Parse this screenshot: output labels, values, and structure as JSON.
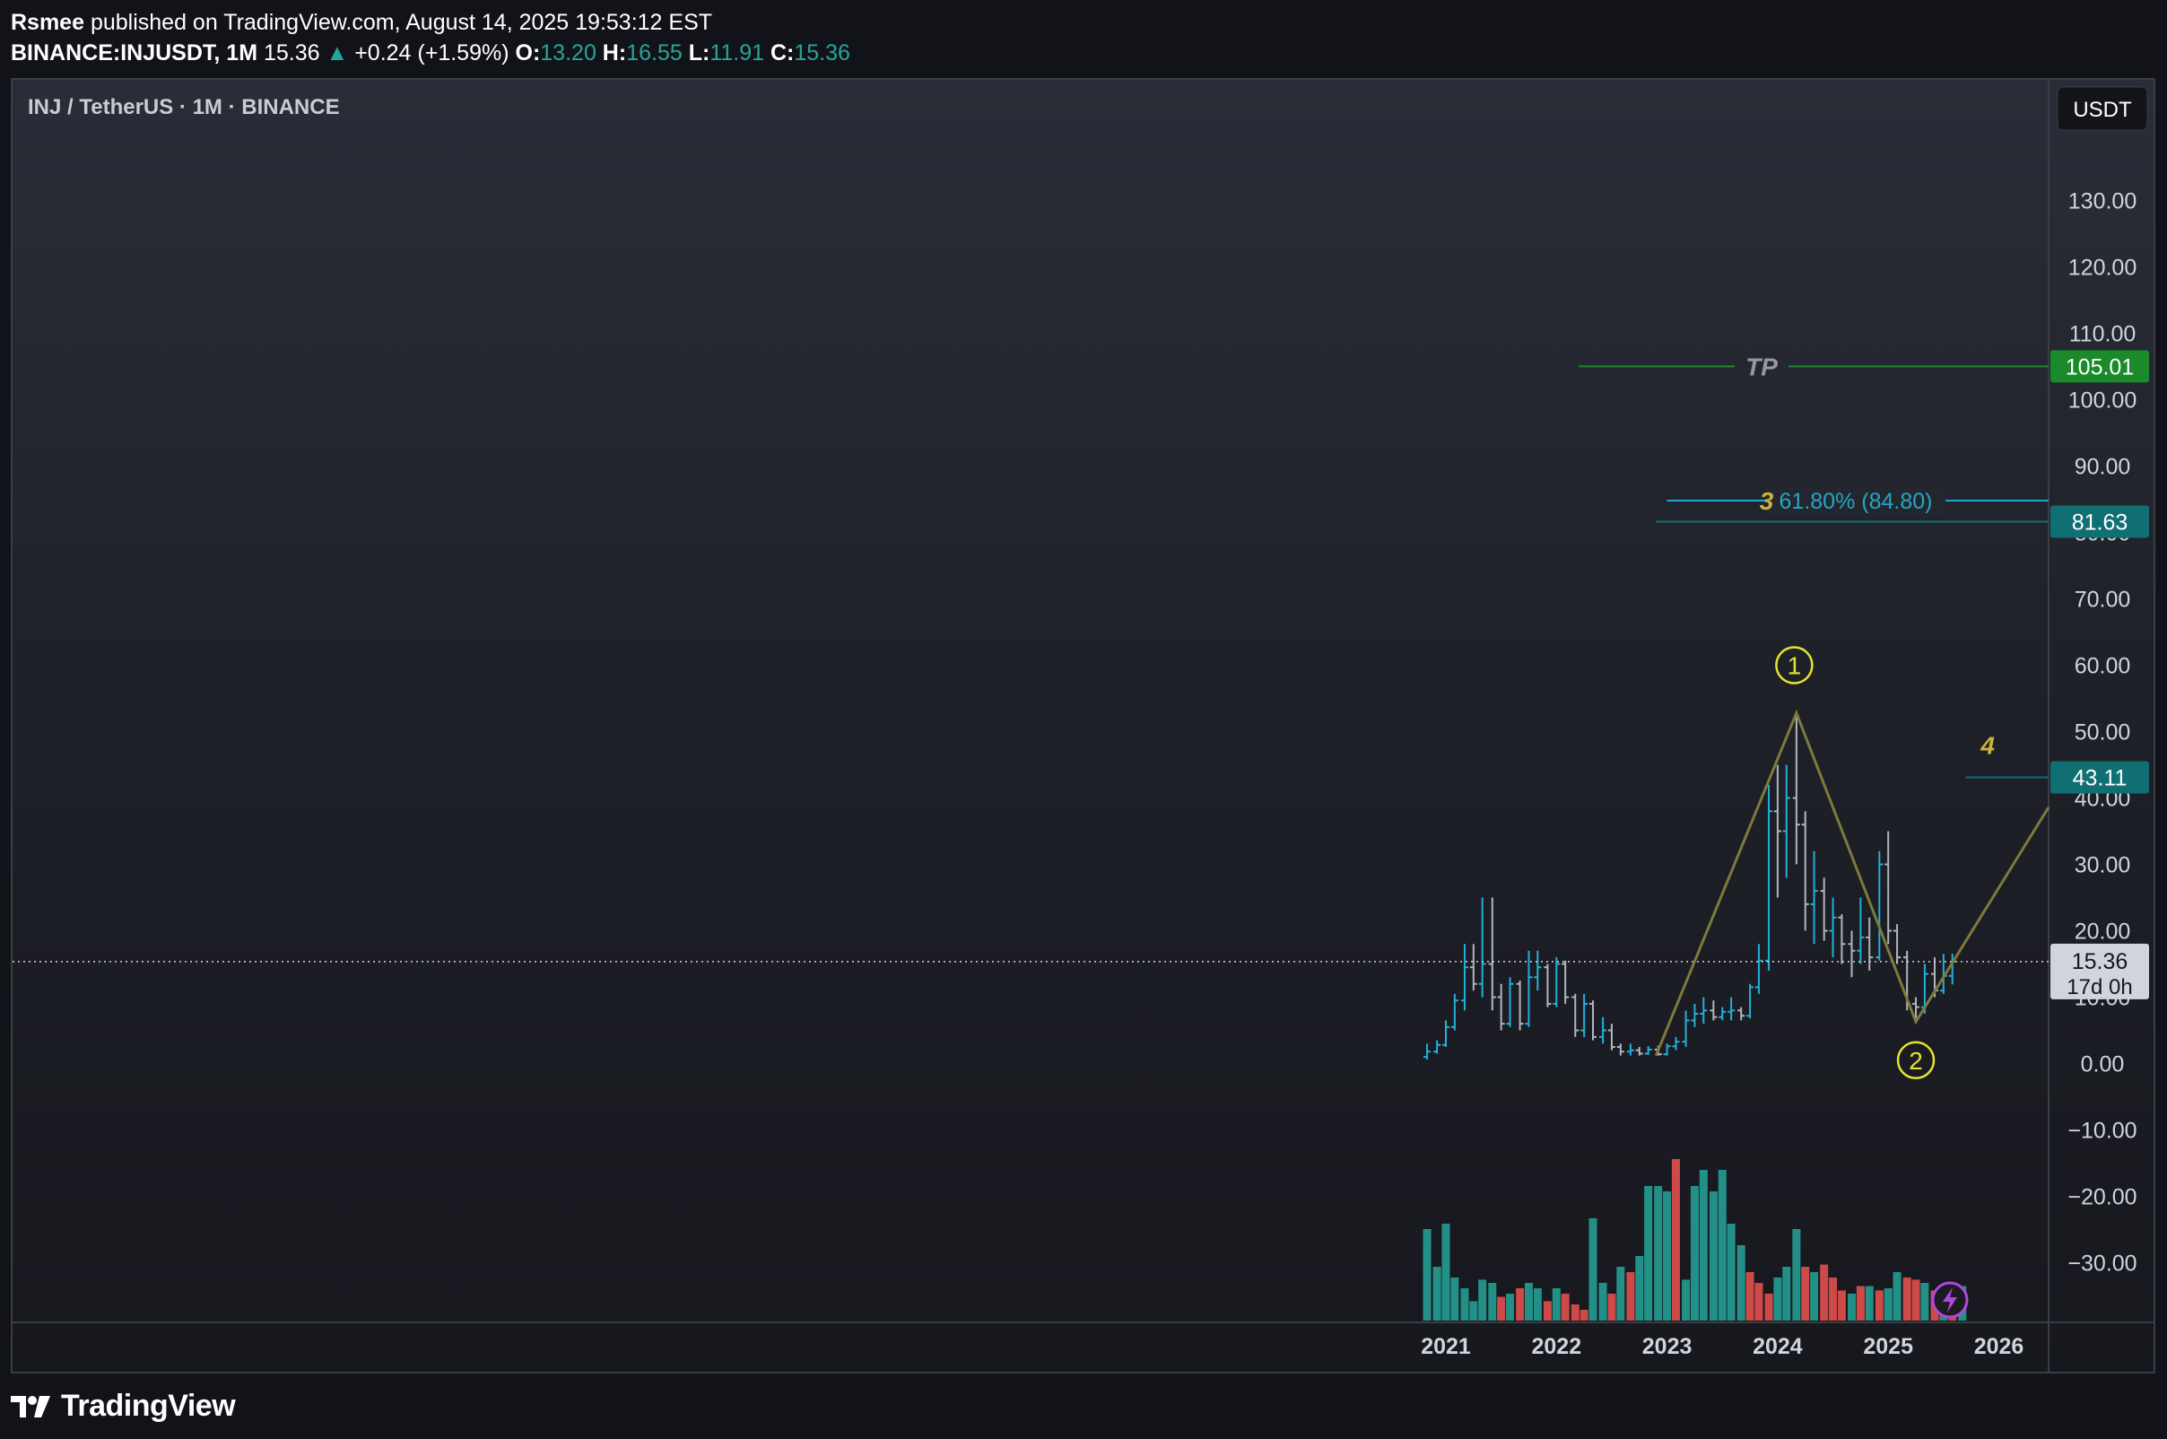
{
  "header": {
    "author": "Rsmee",
    "published": "published on TradingView.com, August 14, 2025 19:53:12 EST",
    "symbol": "BINANCE:INJUSDT, 1M",
    "price": "15.36",
    "change": "+0.24 (+1.59%)",
    "open_label": "O:",
    "open": "13.20",
    "high_label": "H:",
    "high": "16.55",
    "low_label": "L:",
    "low": "11.91",
    "close_label": "C:",
    "close": "15.36"
  },
  "chart_title": "INJ / TetherUS · 1M · BINANCE",
  "currency_button": "USDT",
  "footer": {
    "brand": "TradingView"
  },
  "colors": {
    "up": "#26a69a",
    "down": "#ef5350",
    "wave": "#7d7a3c",
    "tp": "#1b8a2b",
    "fib": "#22a6c8",
    "label_teal": "#0f6f72"
  },
  "chart_data": {
    "type": "candlestick",
    "title": "INJ / TetherUS · 1M · BINANCE",
    "y_axis": {
      "position": "right",
      "ticks": [
        130,
        120,
        110,
        100,
        90,
        80,
        70,
        60,
        50,
        40,
        30,
        20,
        10,
        0,
        -10,
        -20,
        -30
      ],
      "tick_labels": [
        "130.00",
        "120.00",
        "110.00",
        "100.00",
        "90.00",
        "80.00",
        "70.00",
        "60.00",
        "50.00",
        "40.00",
        "30.00",
        "20.00",
        "10.00",
        "0.00",
        "−10.00",
        "−20.00",
        "−30.00"
      ]
    },
    "x_axis": {
      "ticks": [
        "2021",
        "2022",
        "2023",
        "2024",
        "2025",
        "2026"
      ]
    },
    "price_labels": [
      {
        "value": 105.01,
        "text": "105.01",
        "color": "#1b8a2b"
      },
      {
        "value": 81.63,
        "text": "81.63",
        "color": "#0f6f72"
      },
      {
        "value": 43.11,
        "text": "43.11",
        "color": "#0f6f72"
      },
      {
        "value": 15.36,
        "text": "15.36",
        "sub": "17d 0h",
        "color": "#d1d4dc"
      }
    ],
    "horizontal_lines": [
      {
        "value": 105.01,
        "label": "TP",
        "from": 2022.2,
        "color": "#1b8a2b"
      },
      {
        "value": 84.8,
        "label": "61.80% (84.80)",
        "from": 2023.0,
        "color": "#22a6c8"
      },
      {
        "value": 81.63,
        "from": 2022.9,
        "color": "#0f6f72"
      },
      {
        "value": 43.11,
        "from": 2025.7,
        "color": "#0f6f72"
      }
    ],
    "wave_labels": [
      {
        "text": "1",
        "x": 2024.15,
        "y": 60,
        "style": "circle"
      },
      {
        "text": "2",
        "x": 2025.25,
        "y": 0.5,
        "style": "circle"
      },
      {
        "text": "3",
        "x": 2023.9,
        "y": 84.8,
        "style": "plain"
      },
      {
        "text": "4",
        "x": 2025.9,
        "y": 48,
        "style": "plain"
      }
    ],
    "wave_path": [
      {
        "x": 2022.9,
        "y": 1.2
      },
      {
        "x": 2024.17,
        "y": 52.8
      },
      {
        "x": 2025.25,
        "y": 6.3
      },
      {
        "x": 2026.45,
        "y": 38.6
      }
    ],
    "candles": [
      {
        "t": 2020.83,
        "o": 1.0,
        "h": 3.0,
        "l": 0.6,
        "c": 1.8
      },
      {
        "t": 2020.92,
        "o": 1.8,
        "h": 3.5,
        "l": 1.5,
        "c": 2.8
      },
      {
        "t": 2021.0,
        "o": 2.8,
        "h": 6.5,
        "l": 2.5,
        "c": 5.5
      },
      {
        "t": 2021.08,
        "o": 5.5,
        "h": 10.5,
        "l": 5.0,
        "c": 9.5
      },
      {
        "t": 2021.17,
        "o": 9.5,
        "h": 18.0,
        "l": 8.0,
        "c": 14.5
      },
      {
        "t": 2021.25,
        "o": 14.5,
        "h": 18.0,
        "l": 11.0,
        "c": 12.0
      },
      {
        "t": 2021.33,
        "o": 12.0,
        "h": 25.0,
        "l": 10.0,
        "c": 15.0
      },
      {
        "t": 2021.42,
        "o": 15.0,
        "h": 25.0,
        "l": 8.0,
        "c": 10.0
      },
      {
        "t": 2021.5,
        "o": 10.0,
        "h": 12.0,
        "l": 5.0,
        "c": 6.0
      },
      {
        "t": 2021.58,
        "o": 6.0,
        "h": 13.0,
        "l": 5.5,
        "c": 12.0
      },
      {
        "t": 2021.67,
        "o": 12.0,
        "h": 12.5,
        "l": 5.0,
        "c": 6.0
      },
      {
        "t": 2021.75,
        "o": 6.0,
        "h": 17.0,
        "l": 5.5,
        "c": 13.0
      },
      {
        "t": 2021.83,
        "o": 13.0,
        "h": 17.0,
        "l": 11.0,
        "c": 14.5
      },
      {
        "t": 2021.92,
        "o": 14.5,
        "h": 15.0,
        "l": 8.5,
        "c": 9.0
      },
      {
        "t": 2022.0,
        "o": 9.0,
        "h": 16.0,
        "l": 8.5,
        "c": 15.0
      },
      {
        "t": 2022.08,
        "o": 15.0,
        "h": 15.5,
        "l": 9.0,
        "c": 10.0
      },
      {
        "t": 2022.17,
        "o": 10.0,
        "h": 10.5,
        "l": 4.0,
        "c": 5.0
      },
      {
        "t": 2022.25,
        "o": 5.0,
        "h": 10.5,
        "l": 4.0,
        "c": 9.0
      },
      {
        "t": 2022.33,
        "o": 9.0,
        "h": 9.5,
        "l": 3.5,
        "c": 4.0
      },
      {
        "t": 2022.42,
        "o": 4.0,
        "h": 7.0,
        "l": 3.0,
        "c": 5.0
      },
      {
        "t": 2022.5,
        "o": 5.0,
        "h": 6.0,
        "l": 2.0,
        "c": 2.5
      },
      {
        "t": 2022.58,
        "o": 2.5,
        "h": 3.0,
        "l": 1.2,
        "c": 1.8
      },
      {
        "t": 2022.67,
        "o": 1.8,
        "h": 3.0,
        "l": 1.2,
        "c": 2.0
      },
      {
        "t": 2022.75,
        "o": 2.0,
        "h": 2.5,
        "l": 1.2,
        "c": 1.5
      },
      {
        "t": 2022.83,
        "o": 1.5,
        "h": 2.6,
        "l": 1.3,
        "c": 2.1
      },
      {
        "t": 2022.92,
        "o": 2.1,
        "h": 2.7,
        "l": 1.2,
        "c": 1.4
      },
      {
        "t": 2023.0,
        "o": 1.4,
        "h": 3.0,
        "l": 1.2,
        "c": 2.6
      },
      {
        "t": 2023.08,
        "o": 2.6,
        "h": 4.0,
        "l": 2.0,
        "c": 3.3
      },
      {
        "t": 2023.17,
        "o": 3.3,
        "h": 8.0,
        "l": 2.5,
        "c": 6.5
      },
      {
        "t": 2023.25,
        "o": 6.5,
        "h": 9.0,
        "l": 5.5,
        "c": 7.5
      },
      {
        "t": 2023.33,
        "o": 7.5,
        "h": 10.0,
        "l": 6.0,
        "c": 8.0
      },
      {
        "t": 2023.42,
        "o": 8.0,
        "h": 9.5,
        "l": 6.5,
        "c": 7.0
      },
      {
        "t": 2023.5,
        "o": 7.0,
        "h": 8.5,
        "l": 6.5,
        "c": 7.8
      },
      {
        "t": 2023.58,
        "o": 7.8,
        "h": 10.0,
        "l": 6.5,
        "c": 8.0
      },
      {
        "t": 2023.67,
        "o": 8.0,
        "h": 8.5,
        "l": 6.5,
        "c": 7.2
      },
      {
        "t": 2023.75,
        "o": 7.2,
        "h": 12.0,
        "l": 6.8,
        "c": 11.5
      },
      {
        "t": 2023.83,
        "o": 11.5,
        "h": 18.0,
        "l": 10.5,
        "c": 15.5
      },
      {
        "t": 2023.92,
        "o": 15.5,
        "h": 42.0,
        "l": 14.0,
        "c": 38.0
      },
      {
        "t": 2024.0,
        "o": 38.0,
        "h": 45.0,
        "l": 25.0,
        "c": 35.0
      },
      {
        "t": 2024.08,
        "o": 35.0,
        "h": 45.0,
        "l": 28.0,
        "c": 40.0
      },
      {
        "t": 2024.17,
        "o": 40.0,
        "h": 52.8,
        "l": 30.0,
        "c": 36.0
      },
      {
        "t": 2024.25,
        "o": 36.0,
        "h": 38.0,
        "l": 20.0,
        "c": 24.0
      },
      {
        "t": 2024.33,
        "o": 24.0,
        "h": 32.0,
        "l": 18.0,
        "c": 26.0
      },
      {
        "t": 2024.42,
        "o": 26.0,
        "h": 28.0,
        "l": 18.5,
        "c": 20.0
      },
      {
        "t": 2024.5,
        "o": 20.0,
        "h": 25.0,
        "l": 16.0,
        "c": 22.0
      },
      {
        "t": 2024.58,
        "o": 22.0,
        "h": 22.5,
        "l": 15.0,
        "c": 18.0
      },
      {
        "t": 2024.67,
        "o": 18.0,
        "h": 20.0,
        "l": 13.0,
        "c": 17.0
      },
      {
        "t": 2024.75,
        "o": 17.0,
        "h": 25.0,
        "l": 15.0,
        "c": 19.0
      },
      {
        "t": 2024.83,
        "o": 19.0,
        "h": 22.0,
        "l": 14.0,
        "c": 16.0
      },
      {
        "t": 2024.92,
        "o": 16.0,
        "h": 32.0,
        "l": 15.5,
        "c": 30.0
      },
      {
        "t": 2025.0,
        "o": 30.0,
        "h": 35.0,
        "l": 18.0,
        "c": 20.0
      },
      {
        "t": 2025.08,
        "o": 20.0,
        "h": 21.0,
        "l": 15.0,
        "c": 16.0
      },
      {
        "t": 2025.17,
        "o": 16.0,
        "h": 17.0,
        "l": 8.0,
        "c": 9.0
      },
      {
        "t": 2025.25,
        "o": 9.0,
        "h": 10.0,
        "l": 6.3,
        "c": 8.5
      },
      {
        "t": 2025.33,
        "o": 8.5,
        "h": 15.0,
        "l": 7.5,
        "c": 13.5
      },
      {
        "t": 2025.42,
        "o": 13.5,
        "h": 16.0,
        "l": 10.0,
        "c": 11.0
      },
      {
        "t": 2025.5,
        "o": 11.0,
        "h": 16.5,
        "l": 10.5,
        "c": 13.2
      },
      {
        "t": 2025.58,
        "o": 13.2,
        "h": 16.55,
        "l": 11.91,
        "c": 15.36
      }
    ],
    "volume": [
      {
        "t": 2020.83,
        "v": 0.85,
        "up": true
      },
      {
        "t": 2020.92,
        "v": 0.5,
        "up": true
      },
      {
        "t": 2021.0,
        "v": 0.9,
        "up": true
      },
      {
        "t": 2021.08,
        "v": 0.4,
        "up": true
      },
      {
        "t": 2021.17,
        "v": 0.3,
        "up": true
      },
      {
        "t": 2021.25,
        "v": 0.18,
        "up": true
      },
      {
        "t": 2021.33,
        "v": 0.38,
        "up": true
      },
      {
        "t": 2021.42,
        "v": 0.35,
        "up": true
      },
      {
        "t": 2021.5,
        "v": 0.22,
        "up": false
      },
      {
        "t": 2021.58,
        "v": 0.25,
        "up": true
      },
      {
        "t": 2021.67,
        "v": 0.3,
        "up": false
      },
      {
        "t": 2021.75,
        "v": 0.35,
        "up": true
      },
      {
        "t": 2021.83,
        "v": 0.3,
        "up": true
      },
      {
        "t": 2021.92,
        "v": 0.18,
        "up": false
      },
      {
        "t": 2022.0,
        "v": 0.3,
        "up": true
      },
      {
        "t": 2022.08,
        "v": 0.25,
        "up": false
      },
      {
        "t": 2022.17,
        "v": 0.15,
        "up": false
      },
      {
        "t": 2022.25,
        "v": 0.1,
        "up": false
      },
      {
        "t": 2022.33,
        "v": 0.95,
        "up": true
      },
      {
        "t": 2022.42,
        "v": 0.35,
        "up": true
      },
      {
        "t": 2022.5,
        "v": 0.25,
        "up": false
      },
      {
        "t": 2022.58,
        "v": 0.5,
        "up": true
      },
      {
        "t": 2022.67,
        "v": 0.45,
        "up": false
      },
      {
        "t": 2022.75,
        "v": 0.6,
        "up": true
      },
      {
        "t": 2022.83,
        "v": 1.25,
        "up": true
      },
      {
        "t": 2022.92,
        "v": 1.25,
        "up": true
      },
      {
        "t": 2023.0,
        "v": 1.2,
        "up": true
      },
      {
        "t": 2023.08,
        "v": 1.5,
        "up": false
      },
      {
        "t": 2023.17,
        "v": 0.38,
        "up": true
      },
      {
        "t": 2023.25,
        "v": 1.25,
        "up": true
      },
      {
        "t": 2023.33,
        "v": 1.4,
        "up": true
      },
      {
        "t": 2023.42,
        "v": 1.2,
        "up": true
      },
      {
        "t": 2023.5,
        "v": 1.4,
        "up": true
      },
      {
        "t": 2023.58,
        "v": 0.9,
        "up": true
      },
      {
        "t": 2023.67,
        "v": 0.7,
        "up": true
      },
      {
        "t": 2023.75,
        "v": 0.45,
        "up": false
      },
      {
        "t": 2023.83,
        "v": 0.35,
        "up": false
      },
      {
        "t": 2023.92,
        "v": 0.25,
        "up": false
      },
      {
        "t": 2024.0,
        "v": 0.4,
        "up": true
      },
      {
        "t": 2024.08,
        "v": 0.5,
        "up": true
      },
      {
        "t": 2024.17,
        "v": 0.85,
        "up": true
      },
      {
        "t": 2024.25,
        "v": 0.5,
        "up": false
      },
      {
        "t": 2024.33,
        "v": 0.45,
        "up": true
      },
      {
        "t": 2024.42,
        "v": 0.52,
        "up": false
      },
      {
        "t": 2024.5,
        "v": 0.4,
        "up": false
      },
      {
        "t": 2024.58,
        "v": 0.28,
        "up": false
      },
      {
        "t": 2024.67,
        "v": 0.25,
        "up": true
      },
      {
        "t": 2024.75,
        "v": 0.32,
        "up": false
      },
      {
        "t": 2024.83,
        "v": 0.32,
        "up": true
      },
      {
        "t": 2024.92,
        "v": 0.28,
        "up": false
      },
      {
        "t": 2025.0,
        "v": 0.3,
        "up": true
      },
      {
        "t": 2025.08,
        "v": 0.45,
        "up": true
      },
      {
        "t": 2025.17,
        "v": 0.4,
        "up": false
      },
      {
        "t": 2025.25,
        "v": 0.38,
        "up": false
      },
      {
        "t": 2025.33,
        "v": 0.35,
        "up": true
      },
      {
        "t": 2025.42,
        "v": 0.28,
        "up": false
      },
      {
        "t": 2025.5,
        "v": 0.33,
        "up": true
      },
      {
        "t": 2025.58,
        "v": 0.28,
        "up": false
      },
      {
        "t": 2025.67,
        "v": 0.32,
        "up": true
      }
    ]
  }
}
